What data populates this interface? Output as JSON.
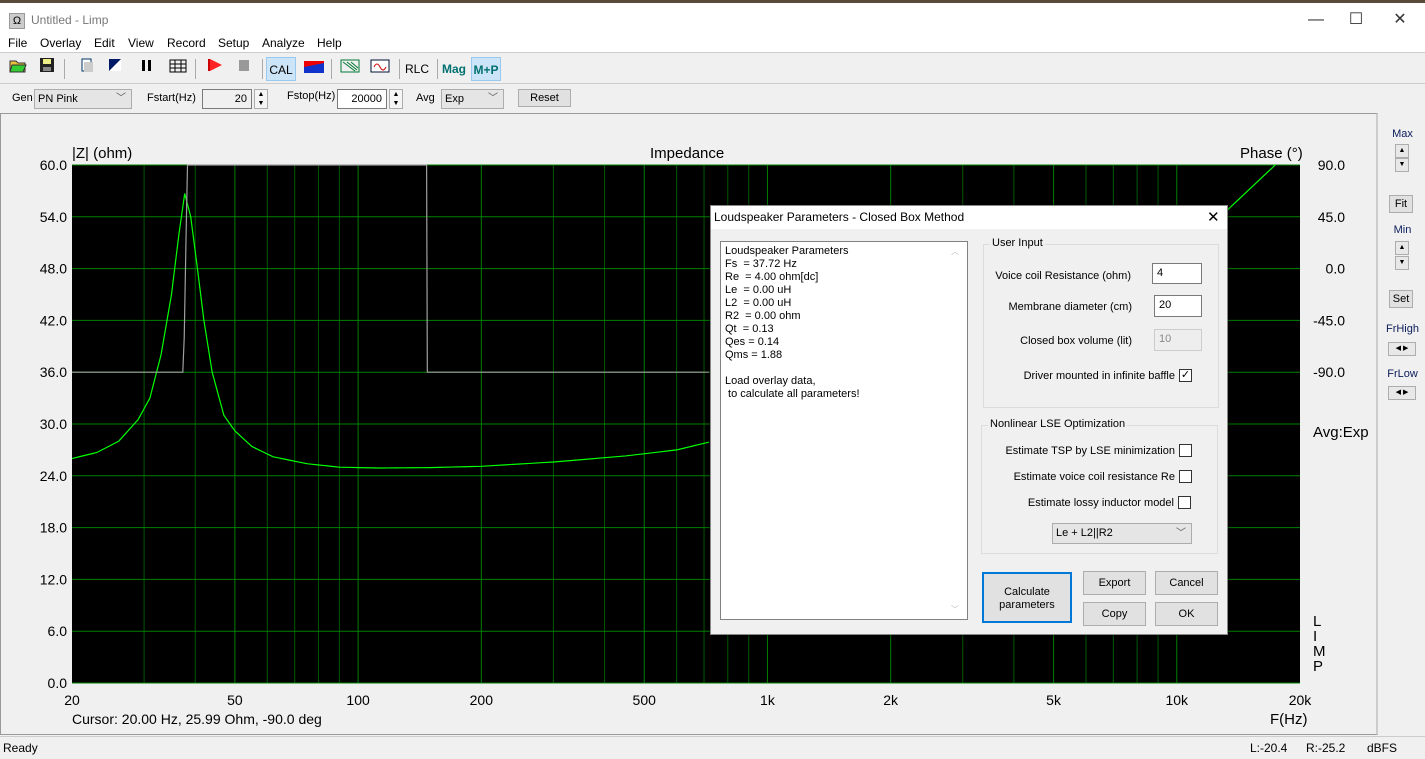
{
  "window": {
    "title": "Untitled - Limp",
    "icon": "omega-icon",
    "minimize": "—",
    "maximize": "☐",
    "close": "✕"
  },
  "menu": [
    "File",
    "Overlay",
    "Edit",
    "View",
    "Record",
    "Setup",
    "Analyze",
    "Help"
  ],
  "toolbar": {
    "open": "open-folder-icon",
    "save": "save-icon",
    "cal": "CAL",
    "rlc": "RLC",
    "mag": "Mag",
    "mp": "M+P"
  },
  "controls": {
    "gen_label": "Gen",
    "gen_value": "PN Pink",
    "fstart_label": "Fstart(Hz)",
    "fstart_value": "20",
    "fstop_label": "Fstop(Hz)",
    "fstop_value": "20000",
    "avg_label": "Avg",
    "avg_value": "Exp",
    "reset": "Reset"
  },
  "chart_data": {
    "type": "line",
    "title": "Impedance",
    "ylabel": "|Z| (ohm)",
    "y2label": "Phase (°)",
    "xlabel": "F(Hz)",
    "xscale": "log",
    "xlim": [
      20,
      20000
    ],
    "ylim": [
      0,
      60
    ],
    "y2lim": [
      -90,
      90
    ],
    "grid": true,
    "xticks": [
      "20",
      "50",
      "100",
      "200",
      "500",
      "1k",
      "2k",
      "5k",
      "10k",
      "20k"
    ],
    "xtick_values": [
      20,
      50,
      100,
      200,
      500,
      1000,
      2000,
      5000,
      10000,
      20000
    ],
    "yticks": [
      "0.0",
      "6.0",
      "12.0",
      "18.0",
      "24.0",
      "30.0",
      "36.0",
      "42.0",
      "48.0",
      "54.0",
      "60.0"
    ],
    "y2ticks": [
      "90.0",
      "45.0",
      "0.0",
      "-45.0",
      "-90.0"
    ],
    "series": [
      {
        "label": "impedance",
        "color": "#00ff00",
        "points": [
          [
            20,
            26.0
          ],
          [
            23,
            26.7
          ],
          [
            26,
            28
          ],
          [
            29,
            30.5
          ],
          [
            31,
            33
          ],
          [
            33,
            38
          ],
          [
            35,
            45
          ],
          [
            36.5,
            52
          ],
          [
            37.7,
            56.7
          ],
          [
            39,
            54
          ],
          [
            40.5,
            48
          ],
          [
            42,
            42
          ],
          [
            44,
            36
          ],
          [
            47,
            31
          ],
          [
            50,
            29.2
          ],
          [
            55,
            27.4
          ],
          [
            62,
            26.2
          ],
          [
            75,
            25.4
          ],
          [
            90,
            25.0
          ],
          [
            112,
            24.9
          ],
          [
            150,
            24.95
          ],
          [
            200,
            25.1
          ],
          [
            300,
            25.6
          ],
          [
            450,
            26.3
          ],
          [
            600,
            27.0
          ],
          [
            720,
            27.9
          ]
        ]
      },
      {
        "label": "impedance-hf",
        "color": "#00ff00",
        "points": [
          [
            13300,
            54.8
          ],
          [
            17400,
            60
          ]
        ]
      },
      {
        "label": "phase",
        "color": "#a0a0a0",
        "axis": "y2",
        "points": [
          [
            20,
            -90
          ],
          [
            37.3,
            -90
          ],
          [
            37.6,
            -60
          ],
          [
            38.0,
            30
          ],
          [
            38.3,
            90
          ],
          [
            147,
            90
          ],
          [
            147.6,
            -90
          ],
          [
            720,
            -90
          ]
        ]
      }
    ],
    "side_labels": [
      "Avg:Exp",
      "L",
      "I",
      "M",
      "P"
    ]
  },
  "cursor": "Cursor: 20.00 Hz, 25.99 Ohm, -90.0 deg",
  "right_panel": {
    "max": "Max",
    "fit": "Fit",
    "min": "Min",
    "set": "Set",
    "frhigh": "FrHigh",
    "frlow": "FrLow"
  },
  "status": {
    "ready": "Ready",
    "left": "L:-20.4",
    "right": "R:-25.2",
    "unit": "dBFS"
  },
  "dialog": {
    "title": "Loudspeaker Parameters - Closed Box Method",
    "close": "✕",
    "results": "Loudspeaker Parameters\nFs  = 37.72 Hz\nRe  = 4.00 ohm[dc]\nLe  = 0.00 uH\nL2  = 0.00 uH\nR2  = 0.00 ohm\nQt  = 0.13\nQes = 0.14\nQms = 1.88\n\nLoad overlay data,\n to calculate all parameters!",
    "user_input": "User Input",
    "vc_label": "Voice coil Resistance (ohm)",
    "vc_value": "4",
    "md_label": "Membrane diameter (cm)",
    "md_value": "20",
    "cbv_label": "Closed box volume (lit)",
    "cbv_value": "10",
    "baffle_label": "Driver mounted in infinite baffle",
    "baffle_checked": true,
    "lse": "Nonlinear LSE Optimization",
    "tsp_label": "Estimate TSP by LSE minimization",
    "re_label": "Estimate voice coil resistance Re",
    "lossy_label": "Estimate lossy inductor model",
    "model_value": "Le + L2||R2",
    "calc": "Calculate parameters",
    "export": "Export",
    "cancel": "Cancel",
    "copy": "Copy",
    "ok": "OK"
  }
}
